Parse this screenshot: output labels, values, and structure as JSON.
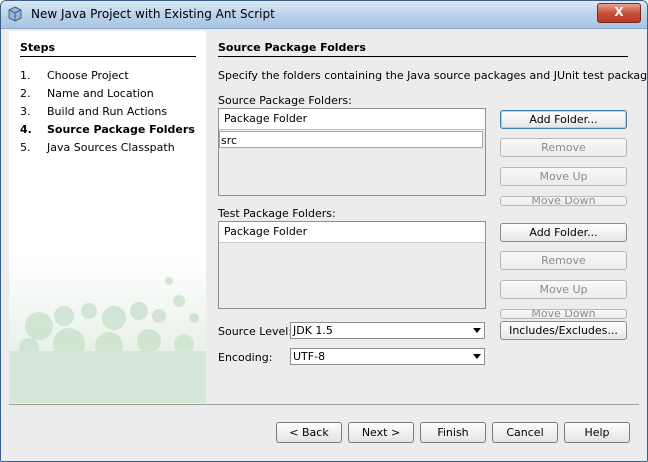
{
  "window": {
    "title": "New Java Project with Existing Ant Script",
    "close_label": "X"
  },
  "steps": {
    "heading": "Steps",
    "items": [
      {
        "num": "1.",
        "label": "Choose Project"
      },
      {
        "num": "2.",
        "label": "Name and Location"
      },
      {
        "num": "3.",
        "label": "Build and Run Actions"
      },
      {
        "num": "4.",
        "label": "Source Package Folders"
      },
      {
        "num": "5.",
        "label": "Java Sources Classpath"
      }
    ],
    "active_index": 3
  },
  "main": {
    "title": "Source Package Folders",
    "description": "Specify the folders containing the Java source packages and JUnit test packages.",
    "source_label": "Source Package Folders:",
    "source_table": {
      "header": "Package Folder",
      "rows": [
        "src"
      ]
    },
    "test_label": "Test Package Folders:",
    "test_table": {
      "header": "Package Folder",
      "rows": []
    },
    "source_buttons": {
      "add": "Add Folder...",
      "remove": "Remove",
      "move_up": "Move Up",
      "move_down": "Move Down"
    },
    "test_buttons": {
      "add": "Add Folder...",
      "remove": "Remove",
      "move_up": "Move Up",
      "move_down": "Move Down"
    },
    "source_level_label": "Source Level:",
    "source_level_value": "JDK 1.5",
    "encoding_label": "Encoding:",
    "encoding_value": "UTF-8",
    "includes_button": "Includes/Excludes..."
  },
  "footer": {
    "back": "< Back",
    "next": "Next >",
    "finish": "Finish",
    "cancel": "Cancel",
    "help": "Help"
  }
}
